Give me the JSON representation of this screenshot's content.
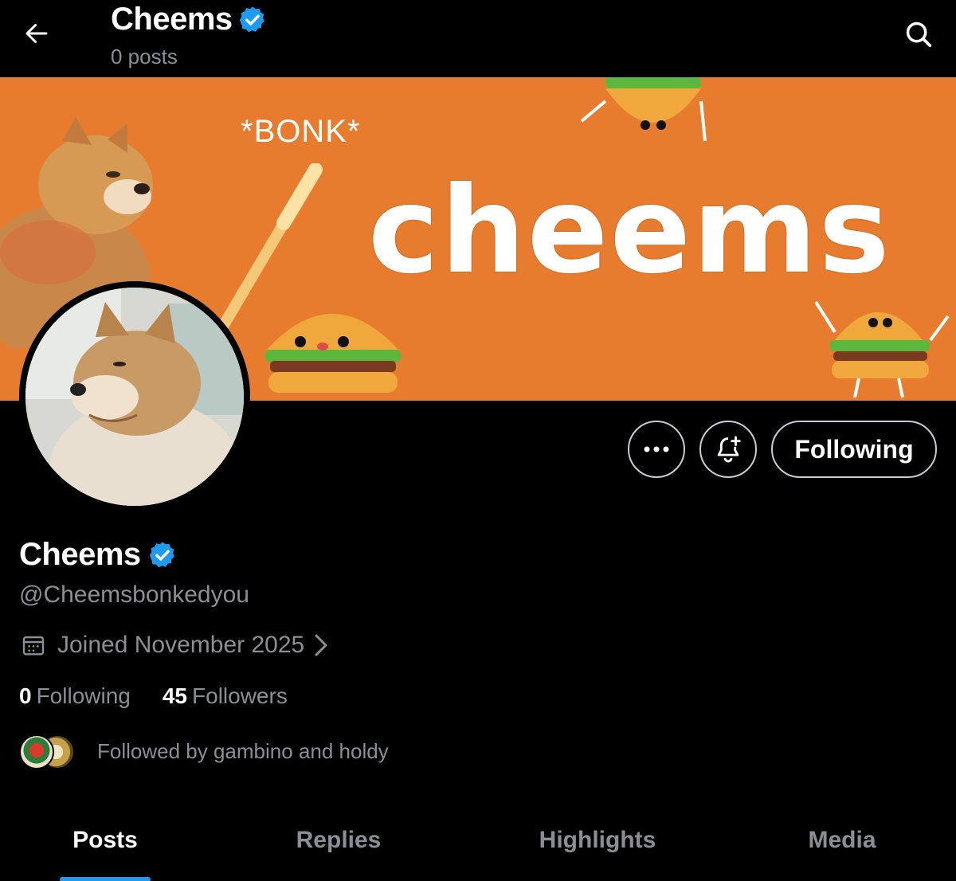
{
  "header": {
    "title": "Cheems",
    "subtitle": "0 posts"
  },
  "banner": {
    "bonk_text": "*BONK*",
    "word": "cheems",
    "background_color": "#e87c2e"
  },
  "actions": {
    "following_label": "Following"
  },
  "profile": {
    "name": "Cheems",
    "handle": "@Cheemsbonkedyou",
    "joined": "Joined November 2025",
    "following_count": "0",
    "following_label": "Following",
    "followers_count": "45",
    "followers_label": "Followers",
    "followed_by": "Followed by gambino and holdy",
    "verified_color": "#1d9bf0"
  },
  "tabs": [
    {
      "label": "Posts",
      "active": true
    },
    {
      "label": "Replies",
      "active": false
    },
    {
      "label": "Highlights",
      "active": false
    },
    {
      "label": "Media",
      "active": false
    }
  ],
  "icons": [
    "back-arrow-icon",
    "verified-badge-icon",
    "search-icon",
    "more-icon",
    "bell-plus-icon",
    "calendar-icon",
    "chevron-right-icon"
  ]
}
